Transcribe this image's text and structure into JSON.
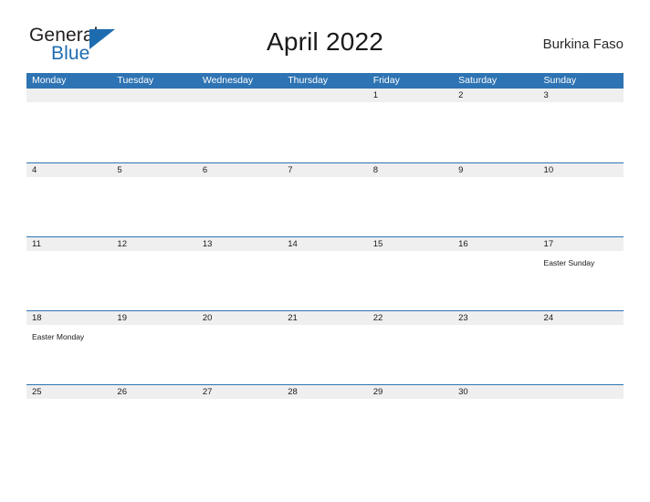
{
  "brand": {
    "word_one": "General",
    "word_two": "Blue",
    "triangle_icon": "triangle-icon",
    "primary_color": "#1e6cb0"
  },
  "header": {
    "title": "April 2022",
    "location": "Burkina Faso"
  },
  "calendar": {
    "header_bg": "#2e73b3",
    "numbar_bg": "#efefef",
    "weekdays": [
      "Monday",
      "Tuesday",
      "Wednesday",
      "Thursday",
      "Friday",
      "Saturday",
      "Sunday"
    ],
    "weeks": [
      {
        "days": [
          {
            "num": "",
            "event": ""
          },
          {
            "num": "",
            "event": ""
          },
          {
            "num": "",
            "event": ""
          },
          {
            "num": "",
            "event": ""
          },
          {
            "num": "1",
            "event": ""
          },
          {
            "num": "2",
            "event": ""
          },
          {
            "num": "3",
            "event": ""
          }
        ]
      },
      {
        "days": [
          {
            "num": "4",
            "event": ""
          },
          {
            "num": "5",
            "event": ""
          },
          {
            "num": "6",
            "event": ""
          },
          {
            "num": "7",
            "event": ""
          },
          {
            "num": "8",
            "event": ""
          },
          {
            "num": "9",
            "event": ""
          },
          {
            "num": "10",
            "event": ""
          }
        ]
      },
      {
        "days": [
          {
            "num": "11",
            "event": ""
          },
          {
            "num": "12",
            "event": ""
          },
          {
            "num": "13",
            "event": ""
          },
          {
            "num": "14",
            "event": ""
          },
          {
            "num": "15",
            "event": ""
          },
          {
            "num": "16",
            "event": ""
          },
          {
            "num": "17",
            "event": "Easter Sunday"
          }
        ]
      },
      {
        "days": [
          {
            "num": "18",
            "event": "Easter Monday"
          },
          {
            "num": "19",
            "event": ""
          },
          {
            "num": "20",
            "event": ""
          },
          {
            "num": "21",
            "event": ""
          },
          {
            "num": "22",
            "event": ""
          },
          {
            "num": "23",
            "event": ""
          },
          {
            "num": "24",
            "event": ""
          }
        ]
      },
      {
        "days": [
          {
            "num": "25",
            "event": ""
          },
          {
            "num": "26",
            "event": ""
          },
          {
            "num": "27",
            "event": ""
          },
          {
            "num": "28",
            "event": ""
          },
          {
            "num": "29",
            "event": ""
          },
          {
            "num": "30",
            "event": ""
          },
          {
            "num": "",
            "event": ""
          }
        ]
      }
    ]
  }
}
